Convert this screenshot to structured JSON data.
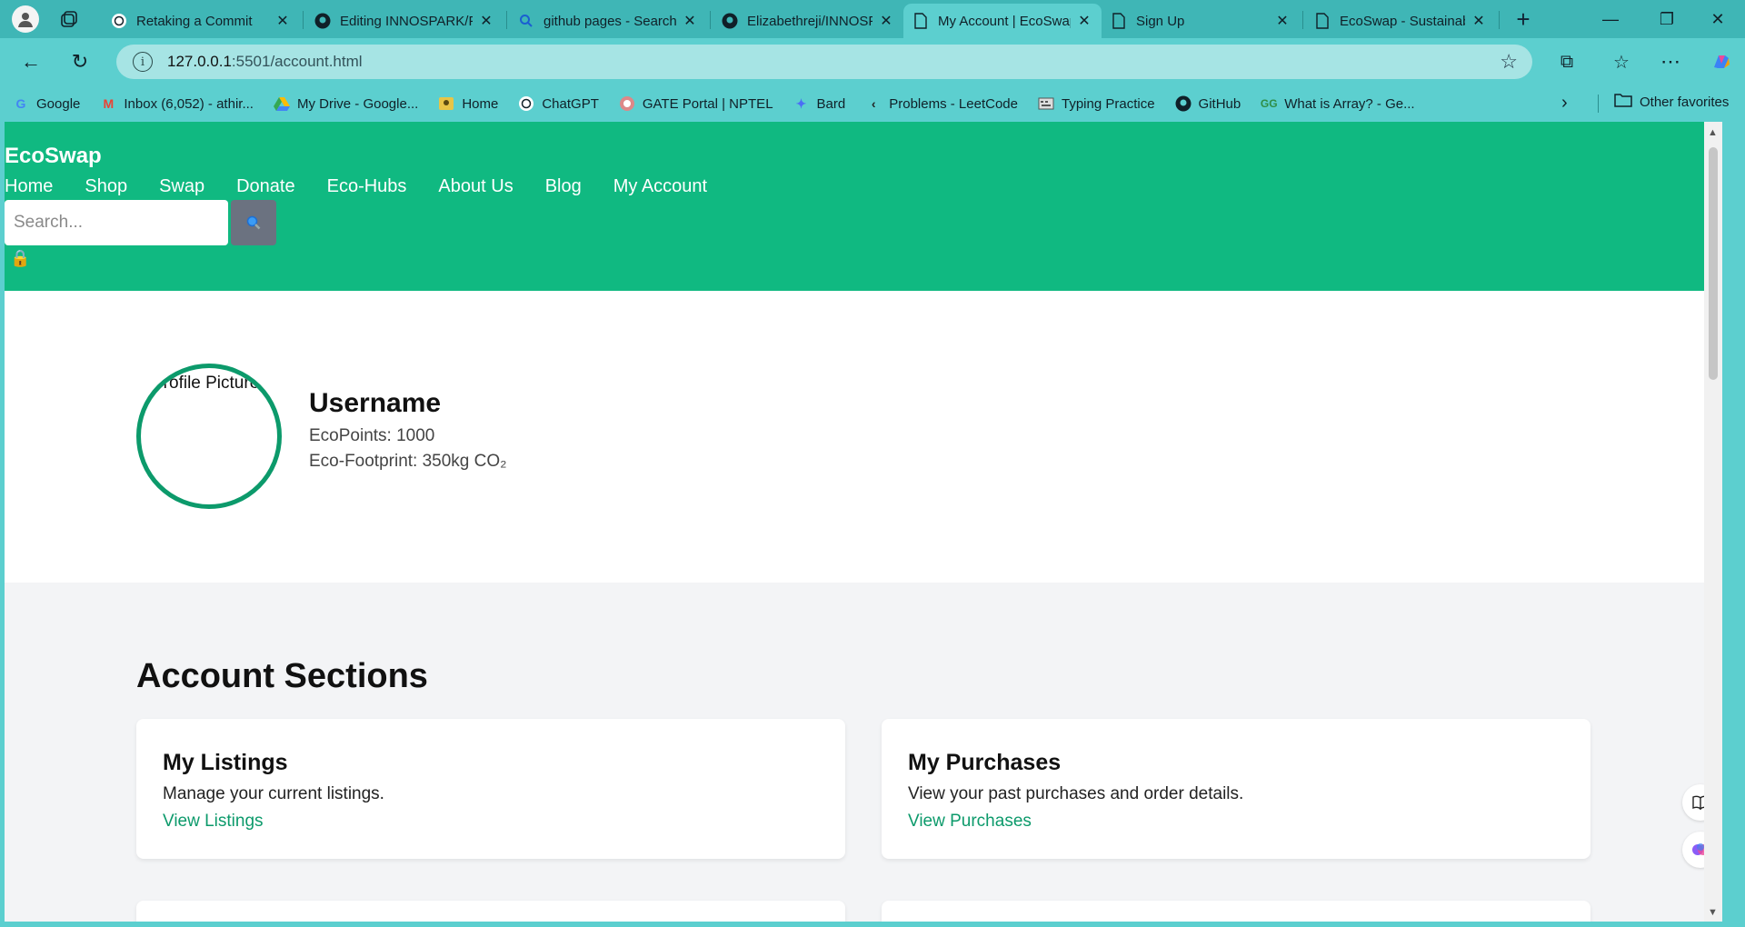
{
  "browser": {
    "tabs": [
      {
        "title": "Retaking a Commit",
        "icon": "chatgpt-icon"
      },
      {
        "title": "Editing INNOSPARK/F",
        "icon": "github-icon"
      },
      {
        "title": "github pages - Search",
        "icon": "search-icon"
      },
      {
        "title": "Elizabethreji/INNOSPARK",
        "icon": "github-icon"
      },
      {
        "title": "My Account | EcoSwap",
        "icon": "page-icon",
        "active": true
      },
      {
        "title": "Sign Up",
        "icon": "page-icon"
      },
      {
        "title": "EcoSwap - Sustainable",
        "icon": "page-icon"
      }
    ],
    "url_host": "127.0.0.1",
    "url_path": ":5501/account.html",
    "bookmarks": [
      {
        "label": "Google",
        "icon": "google-icon"
      },
      {
        "label": "Inbox (6,052) - athir...",
        "icon": "gmail-icon"
      },
      {
        "label": "My Drive - Google...",
        "icon": "drive-icon"
      },
      {
        "label": "Home",
        "icon": "home-icon"
      },
      {
        "label": "ChatGPT",
        "icon": "chatgpt-icon"
      },
      {
        "label": "GATE Portal | NPTEL",
        "icon": "nptel-icon"
      },
      {
        "label": "Bard",
        "icon": "bard-icon"
      },
      {
        "label": "Problems - LeetCode",
        "icon": "leetcode-icon"
      },
      {
        "label": "Typing Practice",
        "icon": "typing-icon"
      },
      {
        "label": "GitHub",
        "icon": "github-icon"
      },
      {
        "label": "What is Array? - Ge...",
        "icon": "gfg-icon"
      }
    ],
    "other_favorites": "Other favorites"
  },
  "site": {
    "logo": "EcoSwap",
    "nav": [
      "Home",
      "Shop",
      "Swap",
      "Donate",
      "Eco-Hubs",
      "About Us",
      "Blog",
      "My Account"
    ],
    "search_placeholder": "Search...",
    "header_color": "#10b981"
  },
  "profile": {
    "avatar_alt": "Profile Picture",
    "username": "Username",
    "ecopoints": "EcoPoints: 1000",
    "footprint": "Eco-Footprint: 350kg CO₂"
  },
  "sections": {
    "heading": "Account Sections",
    "cards": [
      {
        "title": "My Listings",
        "desc": "Manage your current listings.",
        "link": "View Listings"
      },
      {
        "title": "My Purchases",
        "desc": "View your past purchases and order details.",
        "link": "View Purchases"
      }
    ]
  }
}
